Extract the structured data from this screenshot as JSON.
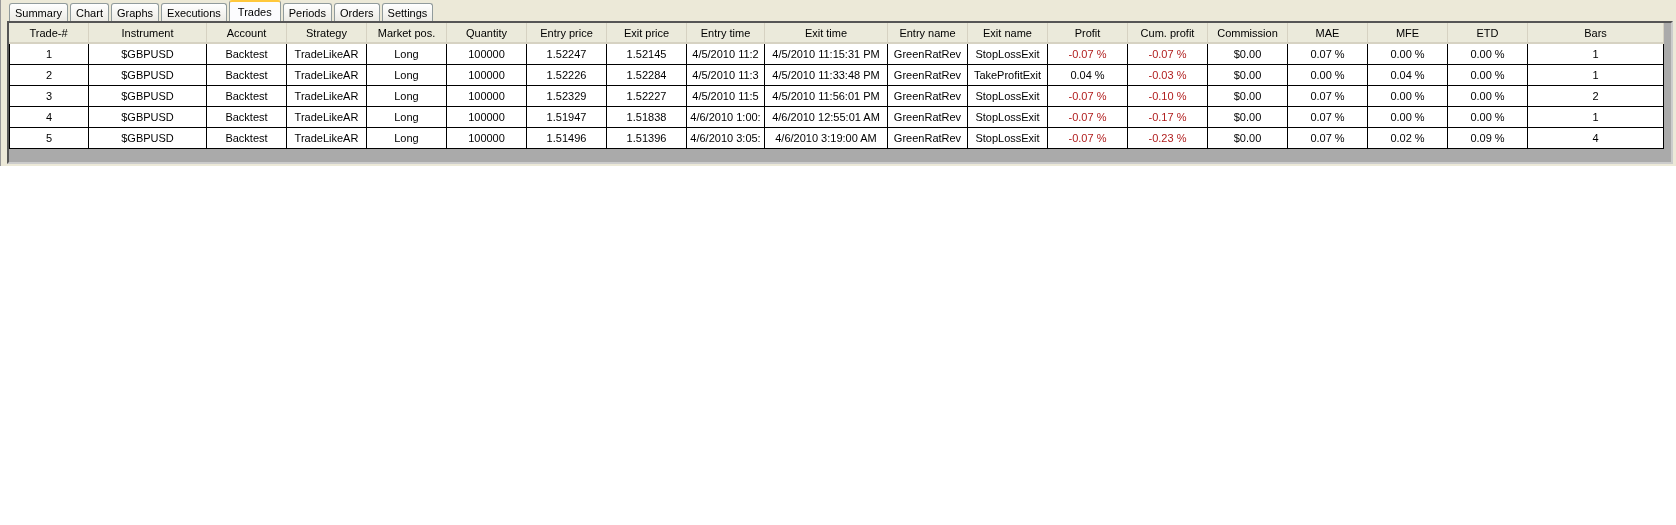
{
  "tabs": [
    {
      "label": "Summary",
      "selected": false
    },
    {
      "label": "Chart",
      "selected": false
    },
    {
      "label": "Graphs",
      "selected": false
    },
    {
      "label": "Executions",
      "selected": false
    },
    {
      "label": "Trades",
      "selected": true
    },
    {
      "label": "Periods",
      "selected": false
    },
    {
      "label": "Orders",
      "selected": false
    },
    {
      "label": "Settings",
      "selected": false
    }
  ],
  "table": {
    "columns": [
      "Trade-#",
      "Instrument",
      "Account",
      "Strategy",
      "Market pos.",
      "Quantity",
      "Entry price",
      "Exit price",
      "Entry time",
      "Exit time",
      "Entry name",
      "Exit name",
      "Profit",
      "Cum. profit",
      "Commission",
      "MAE",
      "MFE",
      "ETD",
      "Bars"
    ],
    "rows": [
      {
        "cells": [
          {
            "text": "1"
          },
          {
            "text": "$GBPUSD"
          },
          {
            "text": "Backtest"
          },
          {
            "text": "TradeLikeAR"
          },
          {
            "text": "Long"
          },
          {
            "text": "100000"
          },
          {
            "text": "1.52247"
          },
          {
            "text": "1.52145"
          },
          {
            "text": "4/5/2010 11:2"
          },
          {
            "text": "4/5/2010 11:15:31 PM"
          },
          {
            "text": "GreenRatRev"
          },
          {
            "text": "StopLossExit"
          },
          {
            "text": "-0.07 %",
            "negative": true
          },
          {
            "text": "-0.07 %",
            "negative": true
          },
          {
            "text": "$0.00"
          },
          {
            "text": "0.07 %"
          },
          {
            "text": "0.00 %"
          },
          {
            "text": "0.00 %"
          },
          {
            "text": "1"
          }
        ]
      },
      {
        "cells": [
          {
            "text": "2"
          },
          {
            "text": "$GBPUSD"
          },
          {
            "text": "Backtest"
          },
          {
            "text": "TradeLikeAR"
          },
          {
            "text": "Long"
          },
          {
            "text": "100000"
          },
          {
            "text": "1.52226"
          },
          {
            "text": "1.52284"
          },
          {
            "text": "4/5/2010 11:3"
          },
          {
            "text": "4/5/2010 11:33:48 PM"
          },
          {
            "text": "GreenRatRev"
          },
          {
            "text": "TakeProfitExit"
          },
          {
            "text": "0.04 %",
            "negative": false
          },
          {
            "text": "-0.03 %",
            "negative": true
          },
          {
            "text": "$0.00"
          },
          {
            "text": "0.00 %"
          },
          {
            "text": "0.04 %"
          },
          {
            "text": "0.00 %"
          },
          {
            "text": "1"
          }
        ]
      },
      {
        "cells": [
          {
            "text": "3"
          },
          {
            "text": "$GBPUSD"
          },
          {
            "text": "Backtest"
          },
          {
            "text": "TradeLikeAR"
          },
          {
            "text": "Long"
          },
          {
            "text": "100000"
          },
          {
            "text": "1.52329"
          },
          {
            "text": "1.52227"
          },
          {
            "text": "4/5/2010 11:5"
          },
          {
            "text": "4/5/2010 11:56:01 PM"
          },
          {
            "text": "GreenRatRev"
          },
          {
            "text": "StopLossExit"
          },
          {
            "text": "-0.07 %",
            "negative": true
          },
          {
            "text": "-0.10 %",
            "negative": true
          },
          {
            "text": "$0.00"
          },
          {
            "text": "0.07 %"
          },
          {
            "text": "0.00 %"
          },
          {
            "text": "0.00 %"
          },
          {
            "text": "2"
          }
        ]
      },
      {
        "cells": [
          {
            "text": "4"
          },
          {
            "text": "$GBPUSD"
          },
          {
            "text": "Backtest"
          },
          {
            "text": "TradeLikeAR"
          },
          {
            "text": "Long"
          },
          {
            "text": "100000"
          },
          {
            "text": "1.51947"
          },
          {
            "text": "1.51838"
          },
          {
            "text": "4/6/2010 1:00:"
          },
          {
            "text": "4/6/2010 12:55:01 AM"
          },
          {
            "text": "GreenRatRev"
          },
          {
            "text": "StopLossExit"
          },
          {
            "text": "-0.07 %",
            "negative": true
          },
          {
            "text": "-0.17 %",
            "negative": true
          },
          {
            "text": "$0.00"
          },
          {
            "text": "0.07 %"
          },
          {
            "text": "0.00 %"
          },
          {
            "text": "0.00 %"
          },
          {
            "text": "1"
          }
        ]
      },
      {
        "cells": [
          {
            "text": "5"
          },
          {
            "text": "$GBPUSD"
          },
          {
            "text": "Backtest"
          },
          {
            "text": "TradeLikeAR"
          },
          {
            "text": "Long"
          },
          {
            "text": "100000"
          },
          {
            "text": "1.51496"
          },
          {
            "text": "1.51396"
          },
          {
            "text": "4/6/2010 3:05:"
          },
          {
            "text": "4/6/2010 3:19:00 AM"
          },
          {
            "text": "GreenRatRev"
          },
          {
            "text": "StopLossExit"
          },
          {
            "text": "-0.07 %",
            "negative": true
          },
          {
            "text": "-0.23 %",
            "negative": true
          },
          {
            "text": "$0.00"
          },
          {
            "text": "0.07 %"
          },
          {
            "text": "0.02 %"
          },
          {
            "text": "0.09 %"
          },
          {
            "text": "4"
          }
        ]
      }
    ]
  }
}
